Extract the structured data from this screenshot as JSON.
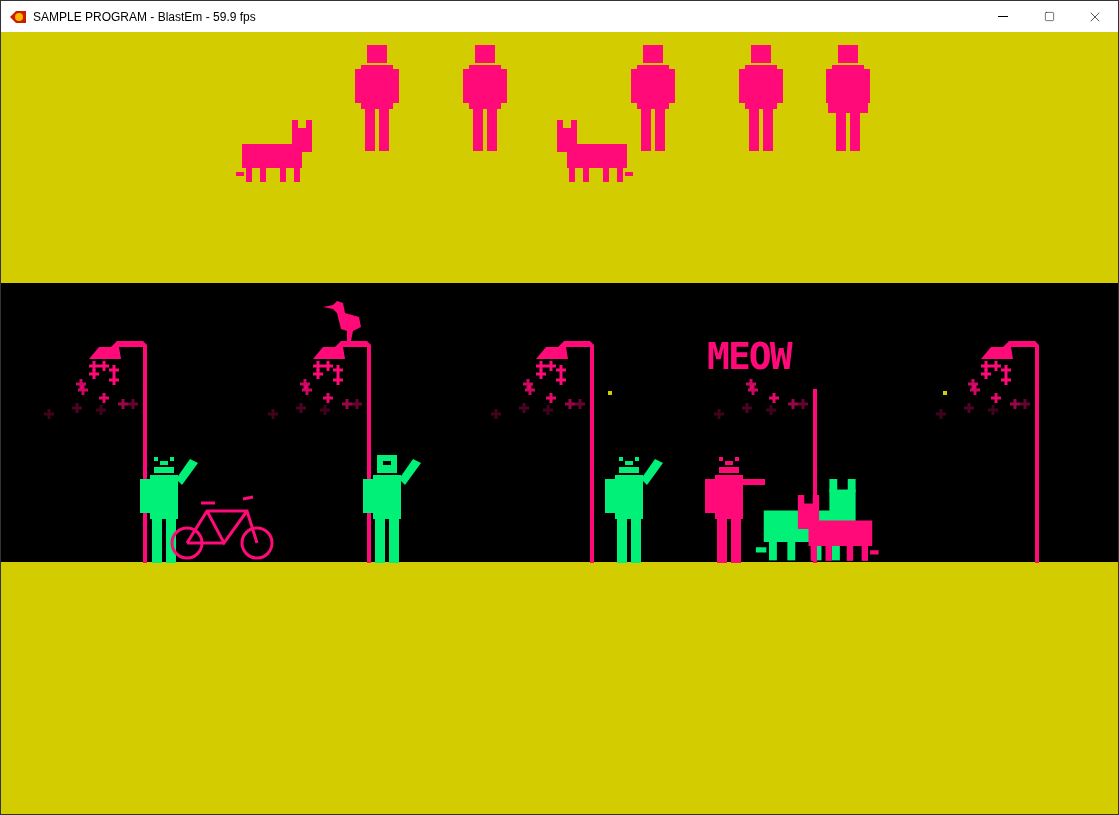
{
  "window": {
    "title": "SAMPLE PROGRAM - BlastEm - 59.9 fps"
  },
  "game": {
    "sign_text": "MEOW"
  }
}
